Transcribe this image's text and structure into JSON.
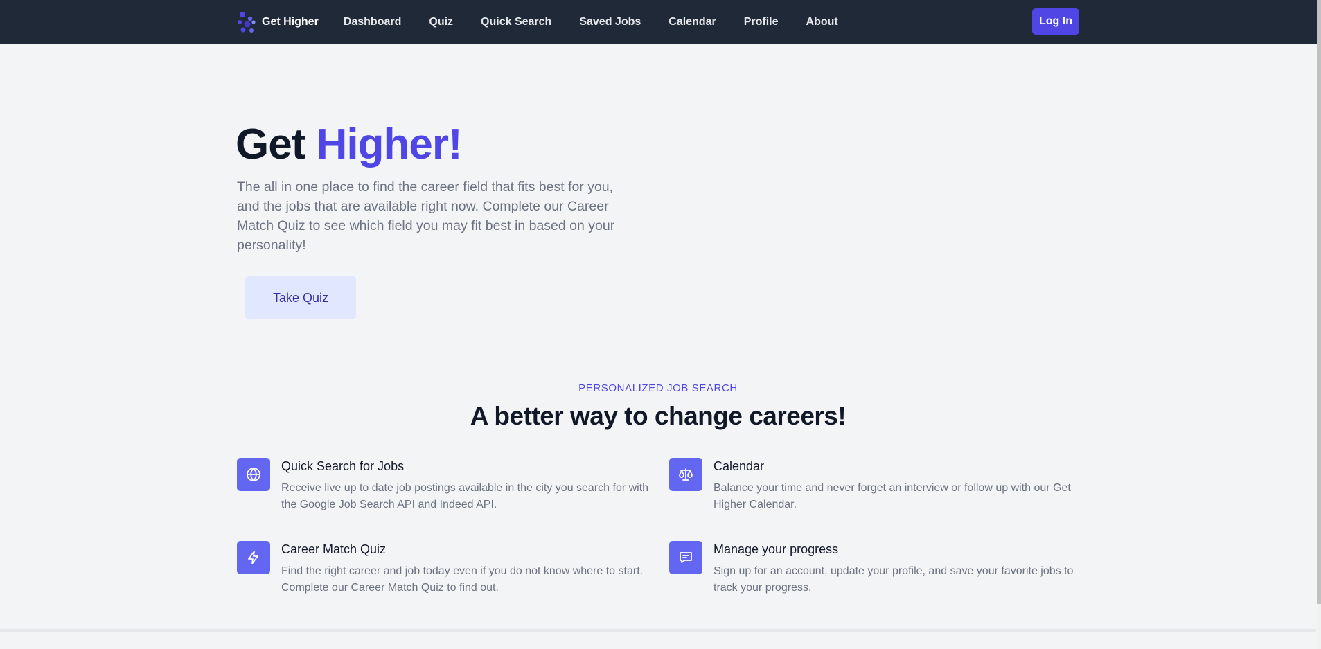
{
  "nav": {
    "brand": "Get Higher",
    "links": [
      "Dashboard",
      "Quiz",
      "Quick Search",
      "Saved Jobs",
      "Calendar",
      "Profile",
      "About"
    ],
    "login_label": "Log In"
  },
  "hero": {
    "title_part1": "Get",
    "title_part2": "Higher!",
    "description": "The all in one place to find the career field that fits best for you, and the jobs that are available right now. Complete our Career Match Quiz to see which field you may fit best in based on your personality!",
    "cta_label": "Take Quiz"
  },
  "features": {
    "eyebrow": "PERSONALIZED JOB SEARCH",
    "title": "A better way to change careers!",
    "items": [
      {
        "icon": "globe-icon",
        "title": "Quick Search for Jobs",
        "description": "Receive live up to date job postings available in the city you search for with the Google Job Search API and Indeed API."
      },
      {
        "icon": "scale-icon",
        "title": "Calendar",
        "description": "Balance your time and never forget an interview or follow up with our Get Higher Calendar."
      },
      {
        "icon": "lightning-bolt-icon",
        "title": "Career Match Quiz",
        "description": "Find the right career and job today even if you do not know where to start. Complete our Career Match Quiz to find out."
      },
      {
        "icon": "chat-annotation-icon",
        "title": "Manage your progress",
        "description": "Sign up for an account, update your profile, and save your favorite jobs to track your progress."
      }
    ]
  },
  "colors": {
    "nav_bg": "#1f2937",
    "accent": "#4f46e5",
    "icon_bg": "#6366f1",
    "page_bg": "#f3f4f6"
  }
}
